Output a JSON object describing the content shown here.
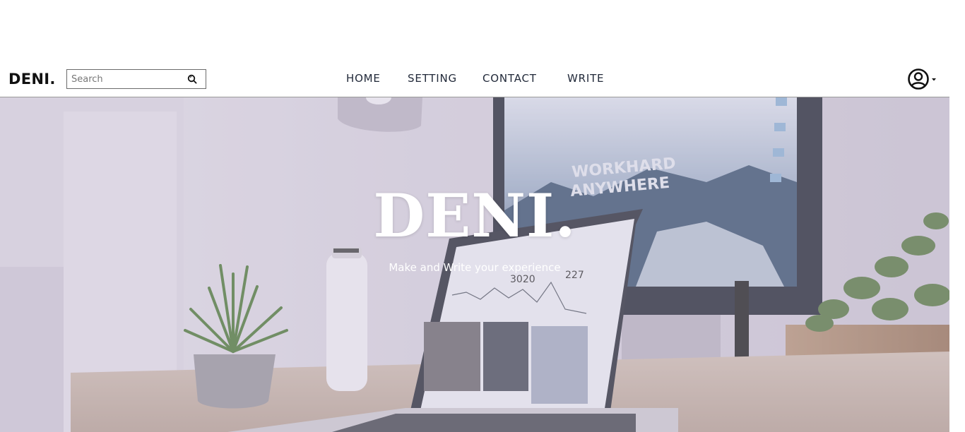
{
  "header": {
    "logo": "DENI.",
    "search": {
      "placeholder": "Search",
      "value": ""
    },
    "nav": [
      {
        "label": "HOME"
      },
      {
        "label": "SETTING"
      },
      {
        "label": "CONTACT"
      },
      {
        "label": "WRITE"
      }
    ],
    "user_icon": "user-circle-icon"
  },
  "hero": {
    "title": "DENI.",
    "subtitle": "Make and Write your experience",
    "monitor_text": [
      "WORKHARD",
      "ANYWHERE"
    ],
    "laptop_numbers": [
      "3020",
      "227"
    ]
  },
  "colors": {
    "nav_text": "#222a3a",
    "overlay": "#c8c2d6",
    "logo": "#111111"
  }
}
